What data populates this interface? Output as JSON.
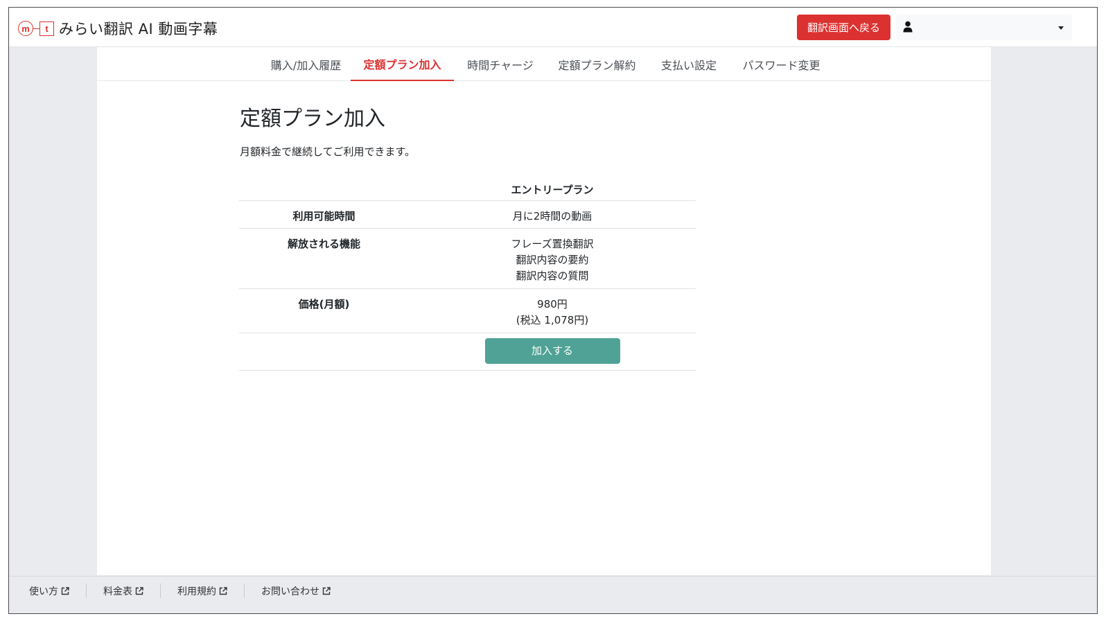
{
  "header": {
    "logo_m": "m",
    "logo_t": "t",
    "app_title": "みらい翻訳 AI 動画字幕",
    "back_button": "翻訳画面へ戻る",
    "user_menu_label": "",
    "accent_color": "#dc3131"
  },
  "tabs": [
    {
      "label": "購入/加入履歴",
      "active": false
    },
    {
      "label": "定額プラン加入",
      "active": true
    },
    {
      "label": "時間チャージ",
      "active": false
    },
    {
      "label": "定額プラン解約",
      "active": false
    },
    {
      "label": "支払い設定",
      "active": false
    },
    {
      "label": "パスワード変更",
      "active": false
    }
  ],
  "main": {
    "title": "定額プラン加入",
    "description": "月額料金で継続してご利用できます。",
    "plan": {
      "name": "エントリープラン",
      "rows": [
        {
          "label": "利用可能時間",
          "values": [
            "月に2時間の動画"
          ]
        },
        {
          "label": "解放される機能",
          "values": [
            "フレーズ置換翻訳",
            "翻訳内容の要約",
            "翻訳内容の質問"
          ]
        },
        {
          "label": "価格(月額)",
          "values": [
            "980円",
            "(税込 1,078円)"
          ]
        }
      ],
      "join_button": "加入する",
      "join_button_color": "#4fa295"
    }
  },
  "footer": {
    "links": [
      "使い方",
      "料金表",
      "利用規約",
      "お問い合わせ"
    ],
    "icon": "external-link-icon"
  }
}
